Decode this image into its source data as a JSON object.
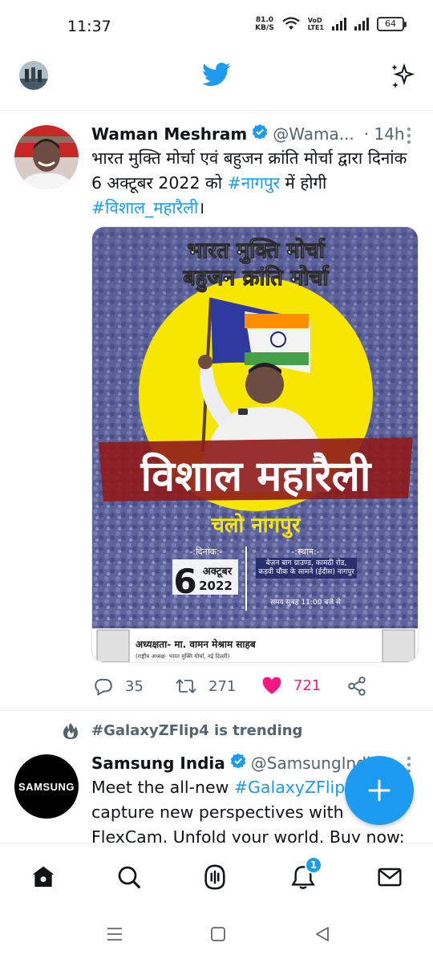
{
  "status_bar": {
    "time": "11:37",
    "net_speed_value": "81.0",
    "net_speed_unit": "KB/S",
    "volte_1": "VoD",
    "volte_2": "LTE1",
    "battery": "64"
  },
  "header": {
    "profile_avatar": "profile-avatar",
    "logo_icon": "twitter-bird-icon",
    "sparkle_icon": "sparkle-icon"
  },
  "tweet1": {
    "name": "Waman Meshram",
    "handle": "@Wama...",
    "time": "· 14h",
    "text_part1": "भारत मुक्ति मोर्चा एवं बहुजन क्रांति मोर्चा द्वारा दिनांक 6 अक्टूबर 2022 को ",
    "hashtag1": "#नागपुर",
    "text_part2": " में होगी ",
    "hashtag2": "#विशाल_महारैली",
    "text_part3": "।",
    "poster": {
      "line1": "भारत मुक्ति मोर्चा",
      "line2": "बहुजन क्रांति मोर्चा",
      "big_title": "विशाल महारैली",
      "subtitle": "चलो नागपुर",
      "date_label": "-:दिनांक:-",
      "date_day": "6",
      "date_month": "अक्टूबर",
      "date_year": "2022",
      "venue_label": "-:स्थान:-",
      "venue_text": "बेज़न बाग ग्राउण्ड, कामठी रोड, कड़वी चौक के सामने (ईदीस) नागपुर",
      "time_text": "समय सुबह 11:00 बजे से",
      "footer_text": "अध्यक्षता- मा. वामन मेश्राम साहब",
      "footer_small": "(राष्ट्रीय अध्यक्ष- भारत मुक्ति मोर्चा, नई दिल्ली)"
    },
    "replies": "35",
    "retweets": "271",
    "likes": "721"
  },
  "trending": {
    "text": "#GalaxyZFlip4 is trending"
  },
  "tweet2": {
    "avatar_text": "SAMSUNG",
    "name": "Samsung India",
    "handle": "@SamsungIndi",
    "text_part1": "Meet the all-new ",
    "hashtag": "#GalaxyZFlip4",
    "text_part2": " can capture new perspectives with FlexCam. Unfold your world. Buy now:"
  },
  "notifications_badge": "1",
  "colors": {
    "brand_blue": "#1d9bf0",
    "like_pink": "#f91880",
    "muted_text": "#536471"
  }
}
